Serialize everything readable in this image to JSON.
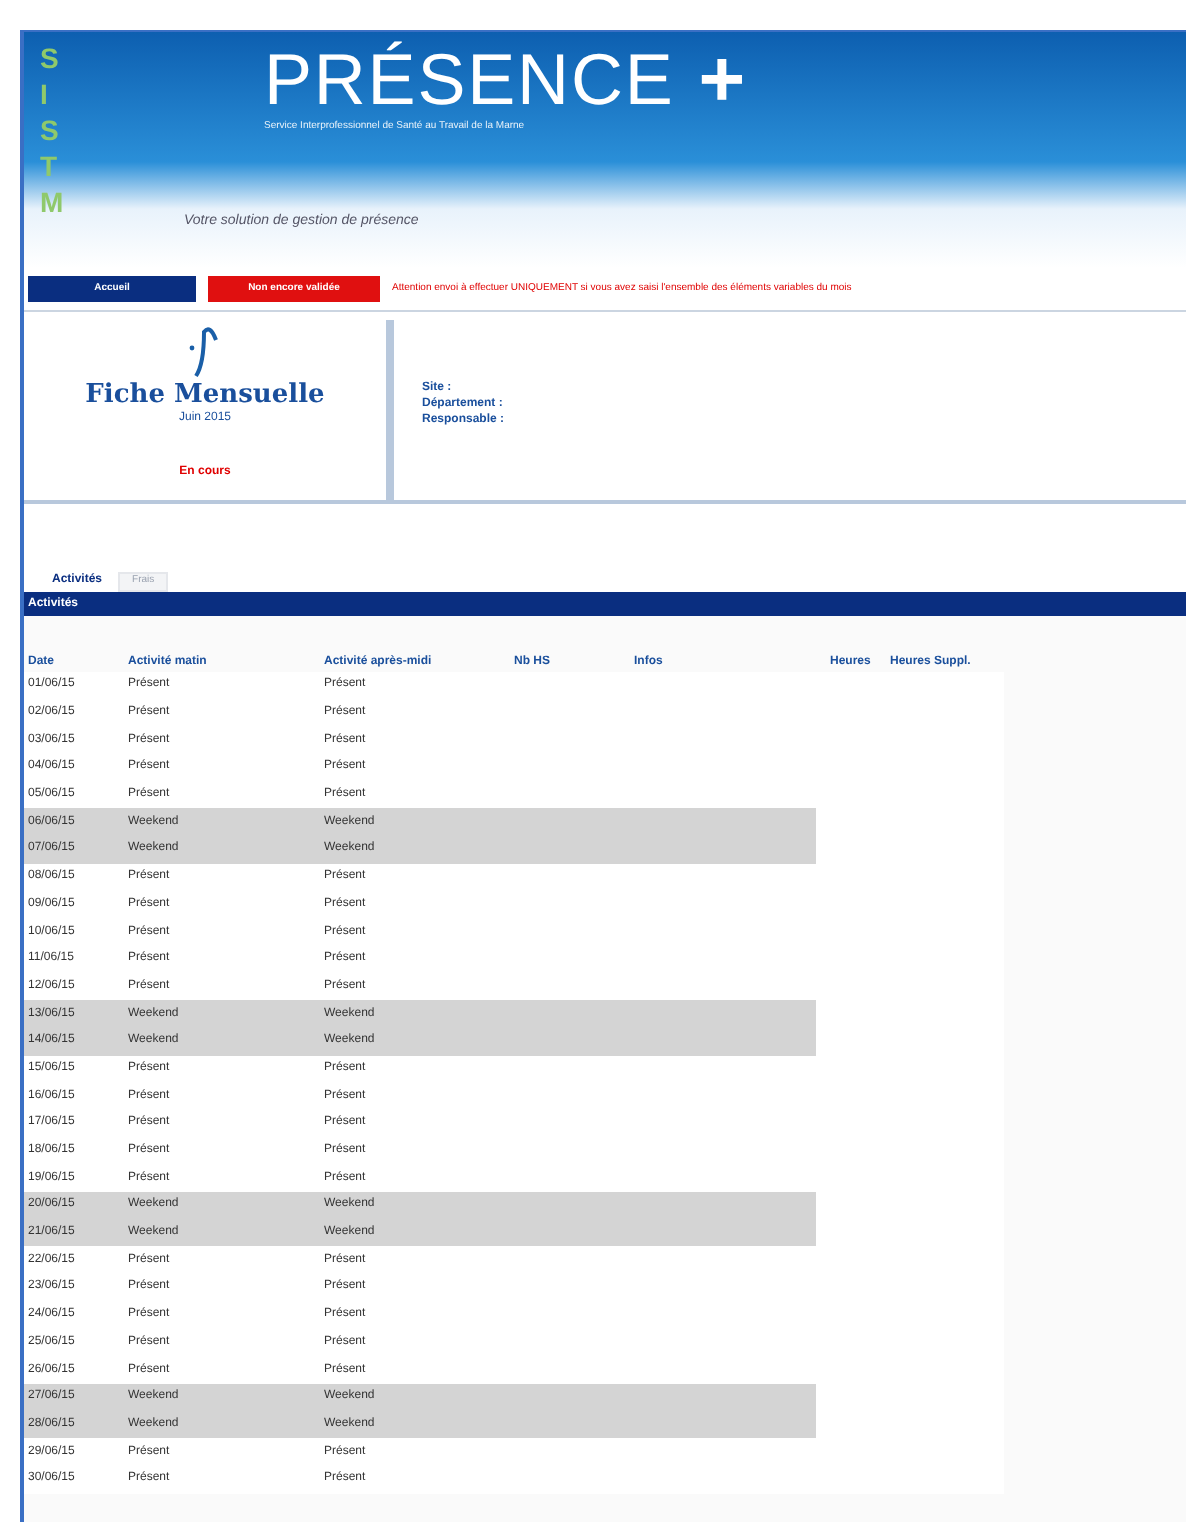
{
  "header": {
    "logo_letters": [
      "S",
      "I",
      "S",
      "T",
      "M"
    ],
    "title": "PRÉSENCE",
    "title_mark": "+",
    "subtitle": "Service Interprofessionnel de Santé au Travail de la Marne",
    "tagline": "Votre solution de gestion de présence"
  },
  "toolbar": {
    "buttons": [
      {
        "label": "Accueil",
        "kind": "primary"
      },
      {
        "label": "Non encore validée",
        "kind": "alert"
      }
    ],
    "warning": "Attention envoi à effectuer UNIQUEMENT si vous avez saisi l'ensemble des éléments variables du mois"
  },
  "sheet": {
    "title": "Fiche Mensuelle",
    "period": "Juin 2015",
    "status": "En cours",
    "fields": [
      "Site :",
      "Département :",
      "Responsable :"
    ]
  },
  "tabs": [
    {
      "label": "Activités",
      "selected": true
    },
    {
      "label": "Frais",
      "selected": false
    }
  ],
  "section_title": "Activités",
  "table": {
    "columns": [
      "Date",
      "Activité matin",
      "Activité après-midi",
      "Nb HS",
      "Infos",
      "Heures",
      "Heures Suppl."
    ],
    "rows": [
      {
        "date": "01/06/15",
        "morning": "Présent",
        "afternoon": "Présent",
        "kind": "work"
      },
      {
        "date": "02/06/15",
        "morning": "Présent",
        "afternoon": "Présent",
        "kind": "work"
      },
      {
        "date": "03/06/15",
        "morning": "Présent",
        "afternoon": "Présent",
        "kind": "work"
      },
      {
        "date": "04/06/15",
        "morning": "Présent",
        "afternoon": "Présent",
        "kind": "work"
      },
      {
        "date": "05/06/15",
        "morning": "Présent",
        "afternoon": "Présent",
        "kind": "work"
      },
      {
        "date": "06/06/15",
        "morning": "Weekend",
        "afternoon": "Weekend",
        "kind": "weekend"
      },
      {
        "date": "07/06/15",
        "morning": "Weekend",
        "afternoon": "Weekend",
        "kind": "weekend"
      },
      {
        "date": "08/06/15",
        "morning": "Présent",
        "afternoon": "Présent",
        "kind": "work"
      },
      {
        "date": "09/06/15",
        "morning": "Présent",
        "afternoon": "Présent",
        "kind": "work"
      },
      {
        "date": "10/06/15",
        "morning": "Présent",
        "afternoon": "Présent",
        "kind": "work"
      },
      {
        "date": "11/06/15",
        "morning": "Présent",
        "afternoon": "Présent",
        "kind": "work"
      },
      {
        "date": "12/06/15",
        "morning": "Présent",
        "afternoon": "Présent",
        "kind": "work"
      },
      {
        "date": "13/06/15",
        "morning": "Weekend",
        "afternoon": "Weekend",
        "kind": "weekend"
      },
      {
        "date": "14/06/15",
        "morning": "Weekend",
        "afternoon": "Weekend",
        "kind": "weekend"
      },
      {
        "date": "15/06/15",
        "morning": "Présent",
        "afternoon": "Présent",
        "kind": "work"
      },
      {
        "date": "16/06/15",
        "morning": "Présent",
        "afternoon": "Présent",
        "kind": "work"
      },
      {
        "date": "17/06/15",
        "morning": "Présent",
        "afternoon": "Présent",
        "kind": "work"
      },
      {
        "date": "18/06/15",
        "morning": "Présent",
        "afternoon": "Présent",
        "kind": "work"
      },
      {
        "date": "19/06/15",
        "morning": "Présent",
        "afternoon": "Présent",
        "kind": "work"
      },
      {
        "date": "20/06/15",
        "morning": "Weekend",
        "afternoon": "Weekend",
        "kind": "weekend"
      },
      {
        "date": "21/06/15",
        "morning": "Weekend",
        "afternoon": "Weekend",
        "kind": "weekend"
      },
      {
        "date": "22/06/15",
        "morning": "Présent",
        "afternoon": "Présent",
        "kind": "work"
      },
      {
        "date": "23/06/15",
        "morning": "Présent",
        "afternoon": "Présent",
        "kind": "work"
      },
      {
        "date": "24/06/15",
        "morning": "Présent",
        "afternoon": "Présent",
        "kind": "work"
      },
      {
        "date": "25/06/15",
        "morning": "Présent",
        "afternoon": "Présent",
        "kind": "work"
      },
      {
        "date": "26/06/15",
        "morning": "Présent",
        "afternoon": "Présent",
        "kind": "work"
      },
      {
        "date": "27/06/15",
        "morning": "Weekend",
        "afternoon": "Weekend",
        "kind": "weekend"
      },
      {
        "date": "28/06/15",
        "morning": "Weekend",
        "afternoon": "Weekend",
        "kind": "weekend"
      },
      {
        "date": "29/06/15",
        "morning": "Présent",
        "afternoon": "Présent",
        "kind": "work"
      },
      {
        "date": "30/06/15",
        "morning": "Présent",
        "afternoon": "Présent",
        "kind": "work"
      }
    ]
  }
}
